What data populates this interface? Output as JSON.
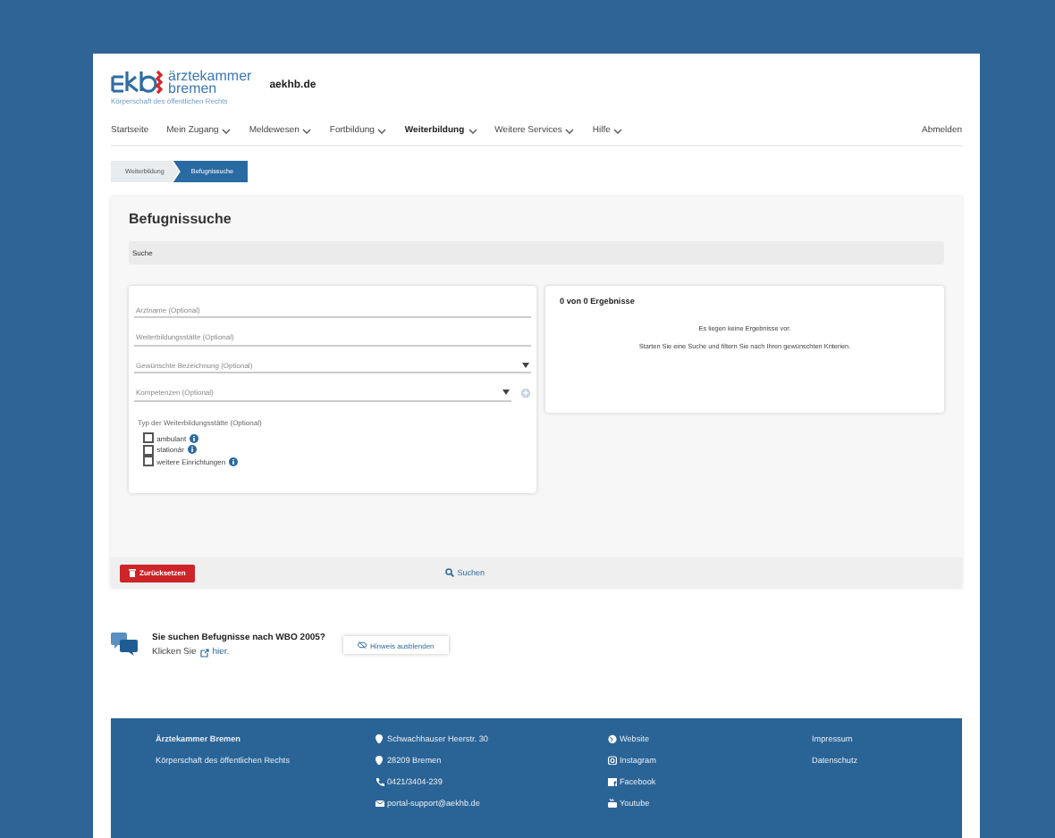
{
  "header": {
    "logo_name": "ärztekammer",
    "logo_city": "bremen",
    "logo_sub": "Körperschaft des öffentlichen Rechts",
    "site": "aekhb.de"
  },
  "nav": {
    "items": [
      {
        "label": "Startseite",
        "dropdown": false,
        "selected": false
      },
      {
        "label": "Mein Zugang",
        "dropdown": true,
        "selected": false
      },
      {
        "label": "Meldewesen",
        "dropdown": true,
        "selected": false
      },
      {
        "label": "Fortbildung",
        "dropdown": true,
        "selected": false
      },
      {
        "label": "Weiterbildung",
        "dropdown": true,
        "selected": true
      },
      {
        "label": "Weitere Services",
        "dropdown": true,
        "selected": false
      },
      {
        "label": "Hilfe",
        "dropdown": true,
        "selected": false
      }
    ],
    "logout": "Abmelden"
  },
  "breadcrumb": [
    {
      "label": "Weiterbildung",
      "selected": false
    },
    {
      "label": "Befugnissuche",
      "selected": true
    }
  ],
  "page": {
    "title": "Befugnissuche",
    "section": "Suche"
  },
  "form": {
    "fields": [
      {
        "kind": "text",
        "placeholder": "Arztname (Optional)"
      },
      {
        "kind": "text",
        "placeholder": "Weiterbildungsstätte (Optional)"
      },
      {
        "kind": "select",
        "placeholder": "Gewünschte Bezeichnung (Optional)"
      },
      {
        "kind": "select-add",
        "placeholder": "Kompetenzen (Optional)"
      }
    ],
    "type_label": "Typ der Weiterbildungsstätte (Optional)",
    "checkboxes": [
      {
        "label": "ambulant",
        "checked": false
      },
      {
        "label": "stationär",
        "checked": false
      },
      {
        "label": "weitere Einrichtungen",
        "checked": false
      }
    ]
  },
  "results": {
    "title": "0 von 0 Ergebnisse",
    "messages": [
      "Es liegen keine Ergebnisse vor.",
      "Starten Sie eine Suche und filtern Sie nach Ihren gewünschten Kriterien."
    ]
  },
  "actions": {
    "reset": "Zurücksetzen",
    "search": "Suchen"
  },
  "hint": {
    "title": "Sie suchen Befugnisse nach WBO 2005?",
    "text": "Klicken Sie",
    "link": "hier.",
    "button": "Hinweis ausblenden"
  },
  "footer": {
    "columns": [
      [
        {
          "text": "Ärztekammer Bremen",
          "bold": true
        },
        {
          "text": "Körperschaft des öffentlichen Rechts",
          "bold": false
        }
      ],
      [
        {
          "text": "Schwachhauser Heerstr. 30",
          "bold": false
        },
        {
          "text": "28209 Bremen",
          "bold": false
        },
        {
          "text": "0421/3404-239",
          "bold": false
        },
        {
          "text": "portal-support@aekhb.de",
          "bold": false
        }
      ],
      [
        {
          "text": "Website",
          "bold": false
        },
        {
          "text": "Instagram",
          "bold": false
        },
        {
          "text": "Facebook",
          "bold": false
        },
        {
          "text": "Youtube",
          "bold": false
        }
      ],
      [
        {
          "text": "Impressum",
          "bold": false
        },
        {
          "text": "Datenschutz",
          "bold": false
        }
      ]
    ]
  }
}
